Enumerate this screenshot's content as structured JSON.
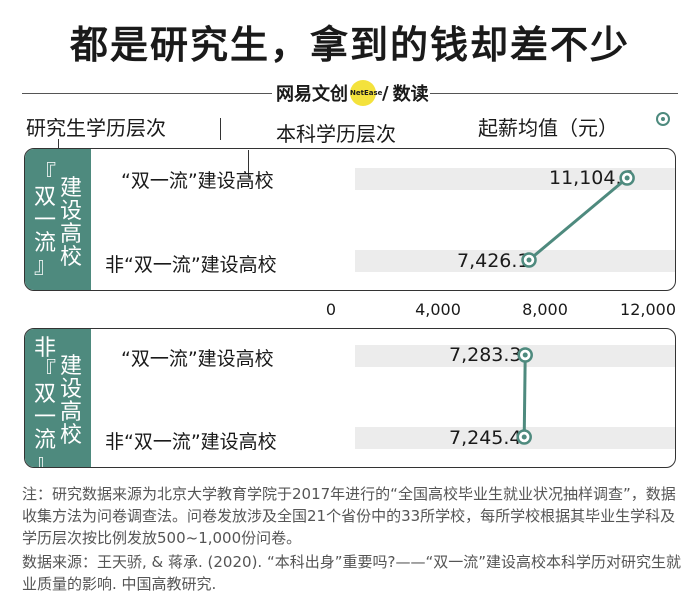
{
  "title": "都是研究生，拿到的钱却差不少",
  "brand": {
    "text_left": "网易文创",
    "dot_text": "NetEase",
    "text_right": "数读"
  },
  "headers": {
    "grad_level": "研究生学历层次",
    "undergrad_level": "本科学历层次",
    "salary": "起薪均值（元）"
  },
  "colors": {
    "accent": "#4e8a7e",
    "band": "#ececec"
  },
  "chart_data": {
    "type": "dot-line",
    "xlim": [
      0,
      12000
    ],
    "x_ticks": [
      "0",
      "4,000",
      "8,000",
      "12,000"
    ],
    "groups": [
      {
        "name": "『双一流』建设高校",
        "rows": [
          {
            "label": "“双一流”建设高校",
            "value": 11104.6,
            "value_label": "11,104.6"
          },
          {
            "label": "非“双一流”建设高校",
            "value": 7426.1,
            "value_label": "7,426.1"
          }
        ]
      },
      {
        "name": "非『双一流』建设高校",
        "rows": [
          {
            "label": "“双一流”建设高校",
            "value": 7283.3,
            "value_label": "7,283.3"
          },
          {
            "label": "非“双一流”建设高校",
            "value": 7245.4,
            "value_label": "7,245.4"
          }
        ]
      }
    ]
  },
  "notes": {
    "note": "注：研究数据来源为北京大学教育学院于2017年进行的“全国高校毕业生就业状况抽样调查”，数据收集方法为问卷调查法。问卷发放涉及全国21个省份中的33所学校，每所学校根据其毕业生学科及学历层次按比例发放500~1,000份问卷。",
    "source": "数据来源：王天骄, & 蒋承. (2020). “本科出身”重要吗?——“双一流”建设高校本科学历对研究生就业质量的影响. 中国高教研究."
  }
}
